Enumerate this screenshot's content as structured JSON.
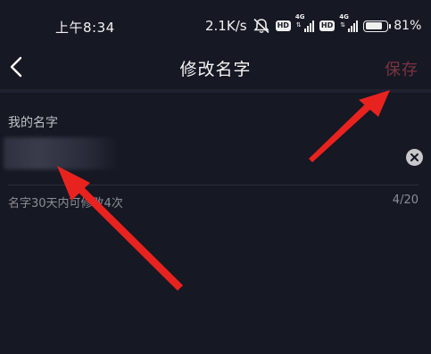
{
  "status_bar": {
    "time": "上午8:34",
    "net_speed": "2.1K/s",
    "hd_badge_1": "HD",
    "sig1_label": "4G",
    "hd_badge_2": "HD",
    "sig2_label": "4G",
    "battery_percent": "81%",
    "battery_level": 0.81,
    "icons": [
      "mute-icon",
      "signal-icon",
      "battery-icon"
    ]
  },
  "nav": {
    "back_icon": "chevron-left-icon",
    "title": "修改名字",
    "save_label": "保存"
  },
  "form": {
    "label": "我的名字",
    "name_value": "",
    "clear_icon": "clear-circle-icon",
    "hint": "名字30天内可修改4次",
    "char_count": "4/20"
  },
  "colors": {
    "background": "#161823",
    "save_disabled": "#7a3441",
    "annotation_arrow": "#e8231f"
  }
}
